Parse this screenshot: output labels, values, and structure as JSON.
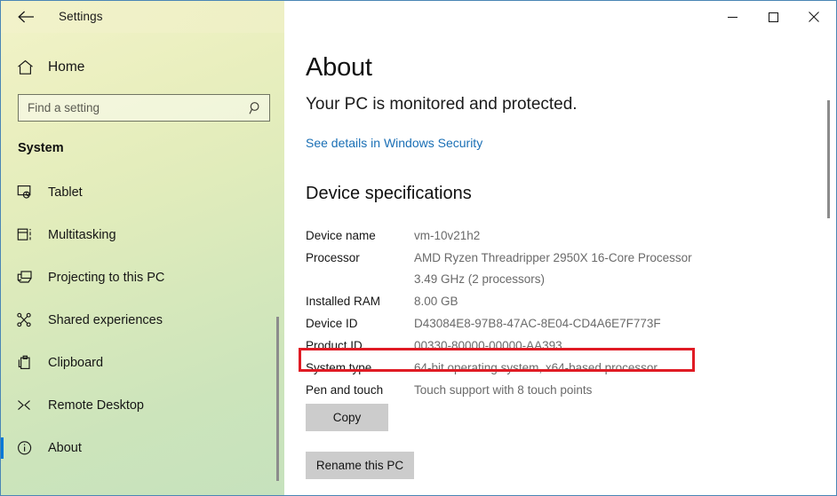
{
  "window": {
    "title": "Settings",
    "back_icon": "back-arrow-icon",
    "minimize_label": "—",
    "maximize_label": "□",
    "close_label": "×"
  },
  "sidebar": {
    "home": {
      "label": "Home",
      "icon": "home-icon"
    },
    "search": {
      "placeholder": "Find a setting",
      "value": "",
      "icon": "search-icon"
    },
    "group_heading": "System",
    "items": [
      {
        "label": "Tablet",
        "icon": "tablet-icon",
        "selected": false
      },
      {
        "label": "Multitasking",
        "icon": "multitasking-icon",
        "selected": false
      },
      {
        "label": "Projecting to this PC",
        "icon": "projecting-icon",
        "selected": false
      },
      {
        "label": "Shared experiences",
        "icon": "shared-experiences-icon",
        "selected": false
      },
      {
        "label": "Clipboard",
        "icon": "clipboard-icon",
        "selected": false
      },
      {
        "label": "Remote Desktop",
        "icon": "remote-desktop-icon",
        "selected": false
      },
      {
        "label": "About",
        "icon": "info-icon",
        "selected": true
      }
    ],
    "selection_color": "#0078d7"
  },
  "main": {
    "page_title": "About",
    "protection_status": "Your PC is monitored and protected.",
    "security_link": "See details in Windows Security",
    "specs_heading": "Device specifications",
    "specs": [
      {
        "key": "Device name",
        "value": "vm-10v21h2",
        "value2": ""
      },
      {
        "key": "Processor",
        "value": "AMD Ryzen Threadripper 2950X 16-Core Processor",
        "value2": "3.49 GHz  (2 processors)"
      },
      {
        "key": "Installed RAM",
        "value": "8.00 GB",
        "value2": ""
      },
      {
        "key": "Device ID",
        "value": "D43084E8-97B8-47AC-8E04-CD4A6E7F773F",
        "value2": ""
      },
      {
        "key": "Product ID",
        "value": "00330-80000-00000-AA393",
        "value2": ""
      },
      {
        "key": "System type",
        "value": "64-bit operating system, x64-based processor",
        "value2": ""
      },
      {
        "key": "Pen and touch",
        "value": "Touch support with 8 touch points",
        "value2": ""
      }
    ],
    "copy_label": "Copy",
    "rename_label": "Rename this PC",
    "highlight_color": "#e01b24",
    "link_color": "#1a6fb5"
  }
}
